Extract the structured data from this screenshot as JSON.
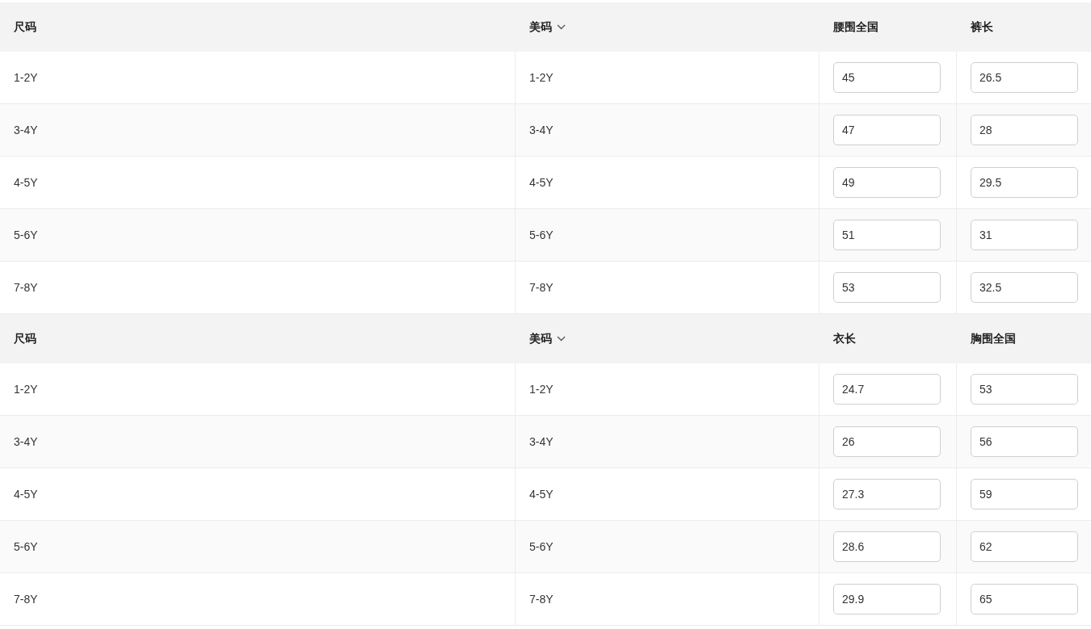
{
  "tables": [
    {
      "columns": [
        {
          "label": "尺码",
          "kind": "plain"
        },
        {
          "label": "美码",
          "kind": "dropdown"
        },
        {
          "label": "腰围全国",
          "kind": "input"
        },
        {
          "label": "裤长",
          "kind": "input"
        }
      ],
      "rows": [
        {
          "cells": [
            "1-2Y",
            "1-2Y",
            "45",
            "26.5"
          ]
        },
        {
          "cells": [
            "3-4Y",
            "3-4Y",
            "47",
            "28"
          ]
        },
        {
          "cells": [
            "4-5Y",
            "4-5Y",
            "49",
            "29.5"
          ]
        },
        {
          "cells": [
            "5-6Y",
            "5-6Y",
            "51",
            "31"
          ]
        },
        {
          "cells": [
            "7-8Y",
            "7-8Y",
            "53",
            "32.5"
          ]
        }
      ]
    },
    {
      "columns": [
        {
          "label": "尺码",
          "kind": "plain"
        },
        {
          "label": "美码",
          "kind": "dropdown"
        },
        {
          "label": "衣长",
          "kind": "input"
        },
        {
          "label": "胸围全国",
          "kind": "input"
        }
      ],
      "rows": [
        {
          "cells": [
            "1-2Y",
            "1-2Y",
            "24.7",
            "53"
          ]
        },
        {
          "cells": [
            "3-4Y",
            "3-4Y",
            "26",
            "56"
          ]
        },
        {
          "cells": [
            "4-5Y",
            "4-5Y",
            "27.3",
            "59"
          ]
        },
        {
          "cells": [
            "5-6Y",
            "5-6Y",
            "28.6",
            "62"
          ]
        },
        {
          "cells": [
            "7-8Y",
            "7-8Y",
            "29.9",
            "65"
          ]
        }
      ]
    }
  ]
}
